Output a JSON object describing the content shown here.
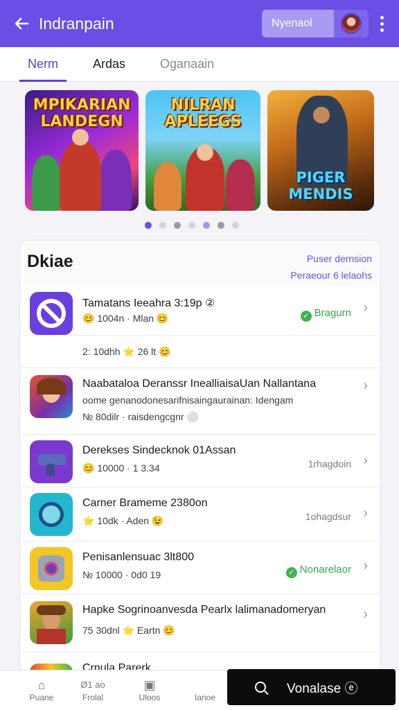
{
  "appbar": {
    "title": "Indranpain",
    "input_value": "Nyenaol",
    "avatar": "avatar"
  },
  "tabs": [
    {
      "label": "Nerm"
    },
    {
      "label": "Ardas"
    },
    {
      "label": "Oganaain"
    }
  ],
  "banners": [
    {
      "title": "MPIKARIAN LANDEGN"
    },
    {
      "title": "NILRAN APLEEGS"
    },
    {
      "title": "PIGER MENDIS"
    }
  ],
  "carousel": {
    "dot_count": 6,
    "active_index": 0
  },
  "card": {
    "title": "Dkiae",
    "link1": "Puser dernsion",
    "link2": "Peraeour 6 lelaohs"
  },
  "rows": [
    {
      "title": "Tamatans Ieeahra 3:19p ②",
      "meta": "😊 1004n · Mlan 😊",
      "meta2": "2: 10dhh ⭐ 26 lt 😊",
      "right": "Bragurn",
      "right_style": "green"
    },
    {
      "title": "Naabataloa Deranssr InealliaisaUan Nallantana",
      "meta": "oome genanodonesarifnisaingaurainan: Idengam",
      "meta2": "№ 80dilr · raisdengcgnr ⚪",
      "right": "",
      "right_style": ""
    },
    {
      "title": "Derekses Sindecknok 01Assan",
      "meta": "😊 10000 · 1 3.34",
      "right": "1rhagdoin",
      "right_style": "gray"
    },
    {
      "title": "Carner Brameme 2380on",
      "meta": "⭐ 10dk · Aden 😉",
      "right": "1ohagdsur",
      "right_style": "gray"
    },
    {
      "title": "Penisanlensuac 3lt800",
      "meta": "№ 10000 · 0d0 19",
      "right": "Nonarelaor",
      "right_style": "green"
    },
    {
      "title": "Hapke Sogrinoanvesda Pearlx lalimanadomeryan",
      "meta": "75 30dnl ⭐ Eartn 😊",
      "right": "",
      "right_style": ""
    },
    {
      "title": "Crnula Parerk",
      "meta": "",
      "right": "",
      "right_style": ""
    }
  ],
  "bottomnav": [
    {
      "label": "Puane",
      "icon": "home-icon"
    },
    {
      "label": "Frolal",
      "icon": "ranking-icon"
    },
    {
      "label": "Uloos",
      "icon": "library-icon"
    },
    {
      "label": "Ianoe",
      "icon": "profile-icon"
    }
  ],
  "bottomnav_badge": "Ø1 ao",
  "fab": {
    "label": "Vonalase ⓔ"
  },
  "colors": {
    "primary": "#6a4ee6",
    "green": "#34a853",
    "star": "#f4b400"
  }
}
